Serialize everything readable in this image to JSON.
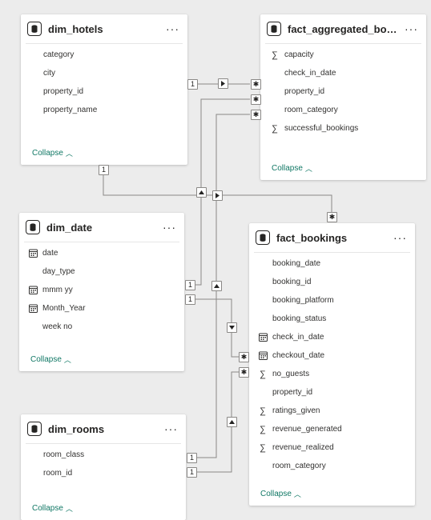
{
  "tables": {
    "dim_hotels": {
      "title": "dim_hotels",
      "fields": [
        {
          "name": "category",
          "icon": "none"
        },
        {
          "name": "city",
          "icon": "none"
        },
        {
          "name": "property_id",
          "icon": "none"
        },
        {
          "name": "property_name",
          "icon": "none"
        }
      ],
      "collapse_label": "Collapse"
    },
    "fact_aggregated_bookings": {
      "title": "fact_aggregated_booki...",
      "fields": [
        {
          "name": "capacity",
          "icon": "sigma-icon",
          "glyph": "∑"
        },
        {
          "name": "check_in_date",
          "icon": "none"
        },
        {
          "name": "property_id",
          "icon": "none"
        },
        {
          "name": "room_category",
          "icon": "none"
        },
        {
          "name": "successful_bookings",
          "icon": "sigma-icon",
          "glyph": "∑"
        }
      ],
      "collapse_label": "Collapse"
    },
    "dim_date": {
      "title": "dim_date",
      "fields": [
        {
          "name": "date",
          "icon": "calendar-icon"
        },
        {
          "name": "day_type",
          "icon": "none"
        },
        {
          "name": "mmm yy",
          "icon": "calendar-icon"
        },
        {
          "name": "Month_Year",
          "icon": "calendar-icon"
        },
        {
          "name": "week no",
          "icon": "none"
        }
      ],
      "collapse_label": "Collapse"
    },
    "fact_bookings": {
      "title": "fact_bookings",
      "fields": [
        {
          "name": "booking_date",
          "icon": "none"
        },
        {
          "name": "booking_id",
          "icon": "none"
        },
        {
          "name": "booking_platform",
          "icon": "none"
        },
        {
          "name": "booking_status",
          "icon": "none"
        },
        {
          "name": "check_in_date",
          "icon": "calendar-icon"
        },
        {
          "name": "checkout_date",
          "icon": "calendar-icon"
        },
        {
          "name": "no_guests",
          "icon": "sigma-icon",
          "glyph": "∑"
        },
        {
          "name": "property_id",
          "icon": "none"
        },
        {
          "name": "ratings_given",
          "icon": "sigma-icon",
          "glyph": "∑"
        },
        {
          "name": "revenue_generated",
          "icon": "sigma-icon",
          "glyph": "∑"
        },
        {
          "name": "revenue_realized",
          "icon": "sigma-icon",
          "glyph": "∑"
        },
        {
          "name": "room_category",
          "icon": "none"
        }
      ],
      "collapse_label": "Collapse"
    },
    "dim_rooms": {
      "title": "dim_rooms",
      "fields": [
        {
          "name": "room_class",
          "icon": "none"
        },
        {
          "name": "room_id",
          "icon": "none"
        }
      ],
      "collapse_label": "Collapse"
    }
  },
  "menu_glyph": "···",
  "cardinality": {
    "one": "1",
    "many": "✱"
  },
  "colors": {
    "accent": "#117865",
    "line": "#8a8886",
    "canvas": "#ececec"
  }
}
